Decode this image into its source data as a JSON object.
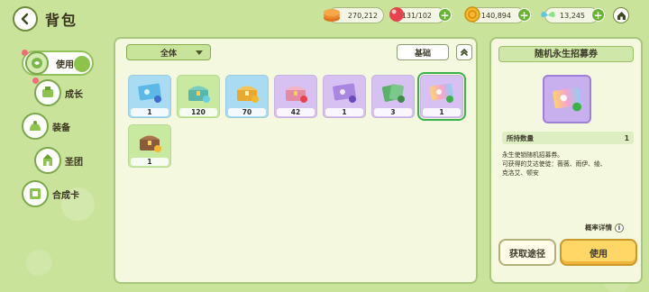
{
  "header": {
    "title": "背包"
  },
  "resources": [
    {
      "name": "coin-stack",
      "value": "270,212",
      "icon": "coin-stack-icon",
      "color": "#f08a2a"
    },
    {
      "name": "red-gem",
      "value": "131/102",
      "icon": "red-gem-icon",
      "color": "#e8434c"
    },
    {
      "name": "gold-coin",
      "value": "140,894",
      "icon": "gold-coin-icon",
      "color": "#f5b82a"
    },
    {
      "name": "wing-token",
      "value": "13,245",
      "icon": "wing-icon",
      "color": "#5fc6e8"
    }
  ],
  "sidebar": {
    "items": [
      {
        "label": "使用",
        "icon": "leaf-bag-icon",
        "active": true
      },
      {
        "label": "成长",
        "icon": "growth-icon"
      },
      {
        "label": "装备",
        "icon": "backpack-icon"
      },
      {
        "label": "圣团",
        "icon": "castle-icon"
      },
      {
        "label": "合成卡",
        "icon": "card-icon"
      }
    ]
  },
  "toolbar": {
    "filter_label": "全体",
    "sort_label": "基础"
  },
  "inventory": [
    {
      "qty": "1",
      "bg": "#a9dcf2",
      "type": "ticket-blue"
    },
    {
      "qty": "120",
      "bg": "#c8eaa0",
      "type": "chest-teal"
    },
    {
      "qty": "70",
      "bg": "#a9dcf2",
      "type": "chest-gold"
    },
    {
      "qty": "42",
      "bg": "#d7c0f2",
      "type": "chest-pink"
    },
    {
      "qty": "1",
      "bg": "#d7c0f2",
      "type": "ticket-purple"
    },
    {
      "qty": "3",
      "bg": "#d7c0f2",
      "type": "cards-green"
    },
    {
      "qty": "1",
      "bg": "#d7c0f2",
      "type": "ticket-rainbow",
      "selected": true
    },
    {
      "qty": "1",
      "bg": "#c8eaa0",
      "type": "chest-brown"
    }
  ],
  "detail": {
    "title": "随机永生招募券",
    "owned_label": "所持数量",
    "owned_value": "1",
    "desc_line1": "永生使锁随机招募券。",
    "desc_line2": "可获得的艾达使徒：薇薇、雨伊、绫、",
    "desc_line3": "克洛艾、顿安",
    "odds_label": "概率详情",
    "get_label": "获取途径",
    "use_label": "使用"
  }
}
